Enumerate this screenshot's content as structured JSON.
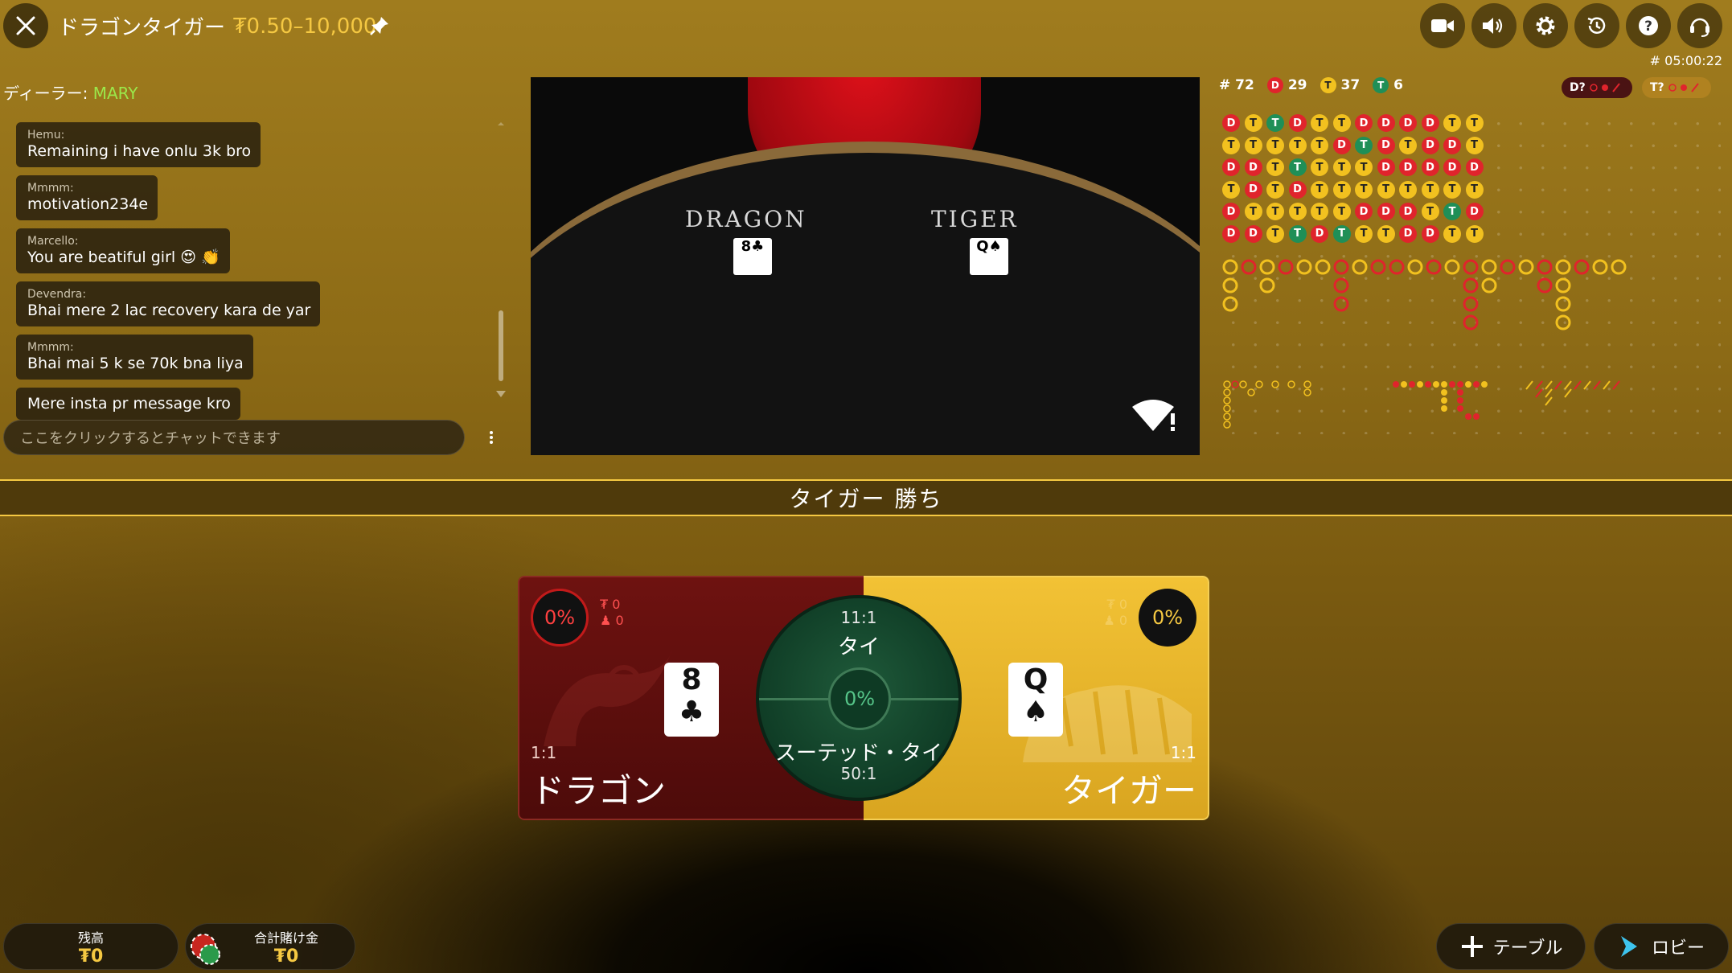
{
  "header": {
    "title": "ドラゴンタイガー",
    "limits": "₮0.50–10,000",
    "round_id": "# 05:00:22"
  },
  "dealer": {
    "label": "ディーラー:",
    "name": "MARY"
  },
  "chat": {
    "messages": [
      {
        "user": "Hemu:",
        "text": "Remaining i have onlu 3k bro"
      },
      {
        "user": "Mmmm:",
        "text": "motivation234e"
      },
      {
        "user": "Marcello:",
        "text": "You are beatiful girl 😍 👏"
      },
      {
        "user": "Devendra:",
        "text": "Bhai mere 2 lac recovery kara de yar"
      },
      {
        "user": "Mmmm:",
        "text": "Bhai mai 5 k se 70k bna liya"
      },
      {
        "user": "",
        "text": "Mere insta pr message kro"
      }
    ],
    "input_placeholder": "ここをクリックするとチャットできます"
  },
  "video": {
    "dragon_label": "DRAGON",
    "tiger_label": "TIGER",
    "dragon_card": "8♣",
    "tiger_card": "Q♠"
  },
  "stats": {
    "round": "# 72",
    "dragon_letter": "D",
    "dragon_count": "29",
    "tiger_letter": "T",
    "tiger_count": "37",
    "tie_letter": "T",
    "tie_count": "6",
    "ask_dragon": "D?",
    "ask_tiger": "T?"
  },
  "bead_road": [
    [
      "D",
      "T",
      "T",
      "D",
      "T",
      "T",
      "D",
      "D",
      "D",
      "D",
      "T",
      "T"
    ],
    [
      "T",
      "T",
      "T",
      "T",
      "T",
      "D",
      "T",
      "D",
      "T",
      "D",
      "D",
      "T"
    ],
    [
      "D",
      "D",
      "T",
      "T",
      "T",
      "T",
      "T",
      "D",
      "D",
      "D",
      "D",
      "D"
    ],
    [
      "T",
      "D",
      "T",
      "D",
      "T",
      "T",
      "T",
      "T",
      "T",
      "T",
      "T",
      "T"
    ],
    [
      "D",
      "T",
      "T",
      "T",
      "T",
      "T",
      "D",
      "D",
      "D",
      "T",
      "T",
      "D"
    ],
    [
      "D",
      "D",
      "T",
      "T",
      "D",
      "T",
      "T",
      "T",
      "D",
      "D",
      "T",
      "T"
    ]
  ],
  "bead_tie_cells": [
    "0-2",
    "2-3",
    "1-6",
    "4-10",
    "5-3",
    "5-5"
  ],
  "result_banner": "タイガー 勝ち",
  "bet": {
    "dragon": {
      "pct": "0%",
      "amount": "₮ 0",
      "players": "0",
      "odds": "1:1",
      "name": "ドラゴン",
      "card_rank": "8",
      "card_suit": "♣"
    },
    "tiger": {
      "pct": "0%",
      "amount": "₮ 0",
      "players": "0",
      "odds": "1:1",
      "name": "タイガー",
      "card_rank": "Q",
      "card_suit": "♠"
    },
    "tie": {
      "odds": "11:1",
      "label": "タイ",
      "pct": "0%",
      "suited_label": "スーテッド・タイ",
      "suited_odds": "50:1"
    }
  },
  "footer": {
    "balance_label": "残高",
    "balance_value": "₮0",
    "total_bet_label": "合計賭け金",
    "total_bet_value": "₮0",
    "table_button": "テーブル",
    "lobby_button": "ロビー"
  },
  "colors": {
    "accent": "#f5c842",
    "dragon": "#e0242c",
    "tiger": "#f2c11f",
    "tie": "#1f8f57",
    "dealer_name": "#9be84a"
  }
}
